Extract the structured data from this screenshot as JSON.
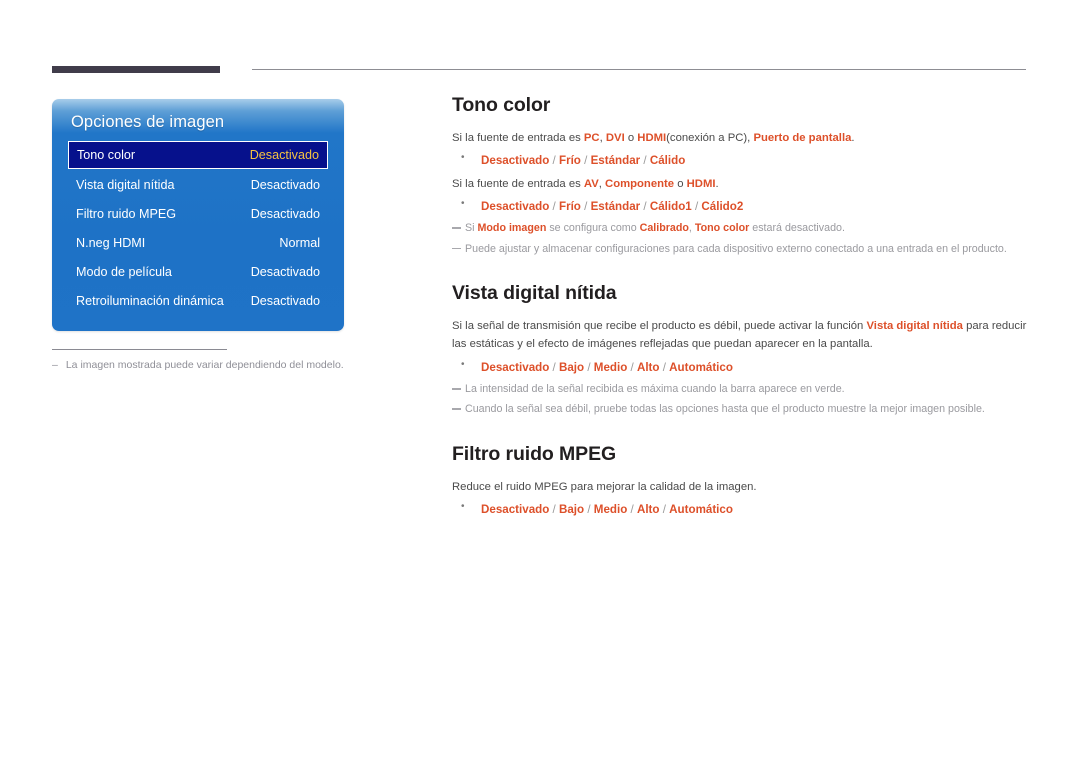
{
  "page": {
    "header_rule_color": "#403c4a",
    "accent_color": "#dd502a",
    "panel_blue": "#1e72c6",
    "selected_row_bg": "#06118c",
    "selected_value_color": "#f5c342"
  },
  "osd": {
    "title": "Opciones de imagen",
    "rows": [
      {
        "label": "Tono color",
        "value": "Desactivado",
        "selected": true
      },
      {
        "label": "Vista digital nítida",
        "value": "Desactivado",
        "selected": false
      },
      {
        "label": "Filtro ruido MPEG",
        "value": "Desactivado",
        "selected": false
      },
      {
        "label": "N.neg HDMI",
        "value": "Normal",
        "selected": false
      },
      {
        "label": "Modo de película",
        "value": "Desactivado",
        "selected": false
      },
      {
        "label": "Retroiluminación dinámica",
        "value": "Desactivado",
        "selected": false
      }
    ],
    "footnote_dash": "–",
    "footnote": "La imagen mostrada puede variar dependiendo del modelo."
  },
  "sections": {
    "tono_color": {
      "title": "Tono color",
      "line1": {
        "t1": "Si la fuente de entrada es ",
        "r1": "PC",
        "t2": ", ",
        "r2": "DVI",
        "t3": " o ",
        "r3": "HDMI",
        "t4": "(conexión a PC), ",
        "r4": "Puerto de pantalla",
        "t5": "."
      },
      "bullet1": {
        "o1": "Desactivado",
        "o2": "Frío",
        "o3": "Estándar",
        "o4": "Cálido"
      },
      "line2": {
        "t1": "Si la fuente de entrada es ",
        "r1": "AV",
        "t2": ", ",
        "r2": "Componente",
        "t3": "  o ",
        "r3": "HDMI",
        "t4": "."
      },
      "bullet2": {
        "o1": "Desactivado",
        "o2": "Frío",
        "o3": "Estándar",
        "o4": "Cálido1",
        "o5": "Cálido2"
      },
      "note1": {
        "t1": "Si ",
        "r1": "Modo imagen",
        "t2": " se configura como ",
        "r2": "Calibrado",
        "t3": ", ",
        "r3": "Tono color",
        "t4": " estará desactivado."
      },
      "note2": "Puede ajustar y almacenar configuraciones para cada dispositivo externo conectado a una entrada en el producto."
    },
    "vista_digital": {
      "title": "Vista digital nítida",
      "para": {
        "t1": "Si la señal de transmisión que recibe el producto es débil, puede activar la función ",
        "r1": "Vista digital nítida",
        "t2": " para reducir las estáticas y el efecto de imágenes reflejadas que puedan aparecer en la pantalla."
      },
      "bullet": {
        "o1": "Desactivado",
        "o2": "Bajo",
        "o3": "Medio",
        "o4": "Alto",
        "o5": "Automático"
      },
      "note1": "La intensidad de la señal recibida es máxima cuando la barra aparece en verde.",
      "note2": "Cuando la señal sea débil, pruebe todas las opciones hasta que el producto muestre la mejor imagen posible."
    },
    "filtro_mpeg": {
      "title": "Filtro ruido MPEG",
      "para": "Reduce el ruido MPEG para mejorar la calidad de la imagen.",
      "bullet": {
        "o1": "Desactivado",
        "o2": "Bajo",
        "o3": "Medio",
        "o4": "Alto",
        "o5": "Automático"
      }
    }
  }
}
